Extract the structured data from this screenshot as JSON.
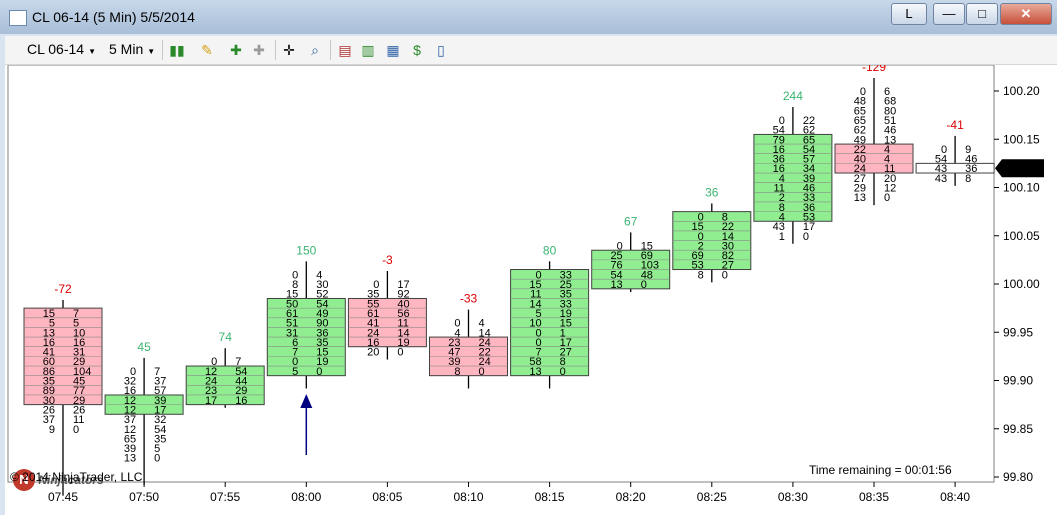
{
  "window": {
    "title": "CL 06-14 (5 Min)  5/5/2014",
    "link_button": "L",
    "minimize": "—",
    "maximize": "□",
    "close": "✕"
  },
  "toolbar": {
    "instrument": "CL 06-14",
    "interval": "5 Min",
    "icons": [
      "bar-type-icon",
      "pencil-draw-icon",
      "insert-indicator-icon",
      "remove-indicator-icon",
      "crosshair-icon",
      "zoom-icon",
      "indicators-icon",
      "strategies-icon",
      "chart-properties-icon",
      "dollar-icon",
      "data-box-icon"
    ]
  },
  "overlay": {
    "copyright": "© 2014 NinjaTrader, LLC",
    "time_remaining": "Time remaining = 00:01:56",
    "logo_text": "Ninjacators"
  },
  "chart_data": {
    "type": "footprint",
    "title": "CL 06-14 (5 Min)  5/5/2014",
    "xlabel": "",
    "ylabel": "",
    "ylim": [
      99.8,
      100.22
    ],
    "tick_size": 0.01,
    "y_ticks": [
      "100.20",
      "100.15",
      "100.10",
      "100.05",
      "100.00",
      "99.95",
      "99.90",
      "99.85",
      "99.80"
    ],
    "x_ticks": [
      "07:45",
      "07:50",
      "07:55",
      "08:00",
      "08:05",
      "08:10",
      "08:15",
      "08:20",
      "08:25",
      "08:30",
      "08:35",
      "08:40"
    ],
    "last_price": "100.12",
    "colors": {
      "up": "#90ee90",
      "down": "#ffb6c1",
      "current": "#ffffff",
      "border": "#404040",
      "delta_pos": "#3cb371",
      "delta_neg": "#dd0000",
      "marker": "#000080"
    },
    "marker": {
      "bar_index": 3
    },
    "bars": [
      {
        "time": "07:45",
        "delta": "-72",
        "direction": "down",
        "open": 99.97,
        "close": 99.88,
        "high": 99.97,
        "low": 99.79,
        "rows": [
          [
            "15",
            "7"
          ],
          [
            "5",
            "5"
          ],
          [
            "13",
            "10"
          ],
          [
            "16",
            "16"
          ],
          [
            "41",
            "31"
          ],
          [
            "60",
            "29"
          ],
          [
            "86",
            "104"
          ],
          [
            "35",
            "45"
          ],
          [
            "89",
            "77"
          ],
          [
            "30",
            "29"
          ],
          [
            "26",
            "26"
          ],
          [
            "37",
            "11"
          ],
          [
            "9",
            "0"
          ]
        ]
      },
      {
        "time": "07:50",
        "delta": "45",
        "direction": "up",
        "open": 99.87,
        "close": 99.88,
        "high": 99.91,
        "low": 99.8,
        "rows": [
          [
            "0",
            "7"
          ],
          [
            "32",
            "37"
          ],
          [
            "16",
            "57"
          ],
          [
            "12",
            "39"
          ],
          [
            "12",
            "17"
          ],
          [
            "37",
            "32"
          ],
          [
            "12",
            "54"
          ],
          [
            "65",
            "35"
          ],
          [
            "39",
            "5"
          ],
          [
            "13",
            "0"
          ]
        ]
      },
      {
        "time": "07:55",
        "delta": "74",
        "direction": "up",
        "open": 99.88,
        "close": 99.91,
        "high": 99.92,
        "low": 99.88,
        "rows": [
          [
            "0",
            "7"
          ],
          [
            "12",
            "54"
          ],
          [
            "24",
            "44"
          ],
          [
            "23",
            "29"
          ],
          [
            "17",
            "16"
          ]
        ]
      },
      {
        "time": "08:00",
        "delta": "150",
        "direction": "up",
        "open": 99.91,
        "close": 99.98,
        "high": 100.01,
        "low": 99.9,
        "rows": [
          [
            "0",
            "4"
          ],
          [
            "8",
            "30"
          ],
          [
            "15",
            "52"
          ],
          [
            "50",
            "54"
          ],
          [
            "61",
            "49"
          ],
          [
            "51",
            "90"
          ],
          [
            "31",
            "36"
          ],
          [
            "6",
            "35"
          ],
          [
            "7",
            "15"
          ],
          [
            "0",
            "19"
          ],
          [
            "5",
            "0"
          ]
        ]
      },
      {
        "time": "08:05",
        "delta": "-3",
        "direction": "down",
        "open": 99.98,
        "close": 99.94,
        "high": 100.0,
        "low": 99.93,
        "rows": [
          [
            "0",
            "17"
          ],
          [
            "35",
            "92"
          ],
          [
            "55",
            "40"
          ],
          [
            "61",
            "56"
          ],
          [
            "41",
            "11"
          ],
          [
            "24",
            "14"
          ],
          [
            "16",
            "19"
          ],
          [
            "20",
            "0"
          ]
        ]
      },
      {
        "time": "08:10",
        "delta": "-33",
        "direction": "down",
        "open": 99.94,
        "close": 99.91,
        "high": 99.96,
        "low": 99.9,
        "rows": [
          [
            "0",
            "4"
          ],
          [
            "4",
            "14"
          ],
          [
            "23",
            "24"
          ],
          [
            "47",
            "22"
          ],
          [
            "39",
            "24"
          ],
          [
            "8",
            "0"
          ]
        ]
      },
      {
        "time": "08:15",
        "delta": "80",
        "direction": "up",
        "open": 99.91,
        "close": 100.01,
        "high": 100.01,
        "low": 99.9,
        "rows": [
          [
            "0",
            "33"
          ],
          [
            "15",
            "25"
          ],
          [
            "11",
            "35"
          ],
          [
            "14",
            "33"
          ],
          [
            "5",
            "19"
          ],
          [
            "10",
            "15"
          ],
          [
            "0",
            "1"
          ],
          [
            "0",
            "17"
          ],
          [
            "7",
            "27"
          ],
          [
            "58",
            "8"
          ],
          [
            "13",
            "0"
          ]
        ]
      },
      {
        "time": "08:20",
        "delta": "67",
        "direction": "up",
        "open": 100.0,
        "close": 100.03,
        "high": 100.04,
        "low": 100.0,
        "rows": [
          [
            "0",
            "15"
          ],
          [
            "25",
            "69"
          ],
          [
            "76",
            "103"
          ],
          [
            "54",
            "48"
          ],
          [
            "13",
            "0"
          ]
        ]
      },
      {
        "time": "08:25",
        "delta": "36",
        "direction": "up",
        "open": 100.02,
        "close": 100.07,
        "high": 100.07,
        "low": 100.01,
        "rows": [
          [
            "0",
            "8"
          ],
          [
            "15",
            "22"
          ],
          [
            "0",
            "14"
          ],
          [
            "2",
            "30"
          ],
          [
            "69",
            "82"
          ],
          [
            "53",
            "27"
          ],
          [
            "8",
            "0"
          ]
        ]
      },
      {
        "time": "08:30",
        "delta": "244",
        "direction": "up",
        "open": 100.07,
        "close": 100.15,
        "high": 100.17,
        "low": 100.05,
        "rows": [
          [
            "0",
            "22"
          ],
          [
            "54",
            "62"
          ],
          [
            "79",
            "65"
          ],
          [
            "16",
            "54"
          ],
          [
            "36",
            "57"
          ],
          [
            "16",
            "34"
          ],
          [
            "4",
            "39"
          ],
          [
            "11",
            "46"
          ],
          [
            "2",
            "33"
          ],
          [
            "8",
            "36"
          ],
          [
            "4",
            "53"
          ],
          [
            "43",
            "17"
          ],
          [
            "1",
            "0"
          ]
        ]
      },
      {
        "time": "08:35",
        "delta": "-129",
        "direction": "down",
        "open": 100.14,
        "close": 100.12,
        "high": 100.2,
        "low": 100.09,
        "rows": [
          [
            "0",
            "6"
          ],
          [
            "48",
            "68"
          ],
          [
            "65",
            "80"
          ],
          [
            "65",
            "51"
          ],
          [
            "62",
            "46"
          ],
          [
            "49",
            "13"
          ],
          [
            "22",
            "4"
          ],
          [
            "40",
            "4"
          ],
          [
            "24",
            "11"
          ],
          [
            "27",
            "20"
          ],
          [
            "29",
            "12"
          ],
          [
            "13",
            "0"
          ]
        ]
      },
      {
        "time": "08:40",
        "delta": "-41",
        "direction": "current",
        "open": 100.12,
        "close": 100.12,
        "high": 100.14,
        "low": 100.11,
        "rows": [
          [
            "0",
            "9"
          ],
          [
            "54",
            "46"
          ],
          [
            "43",
            "36"
          ],
          [
            "43",
            "8"
          ]
        ]
      }
    ]
  }
}
